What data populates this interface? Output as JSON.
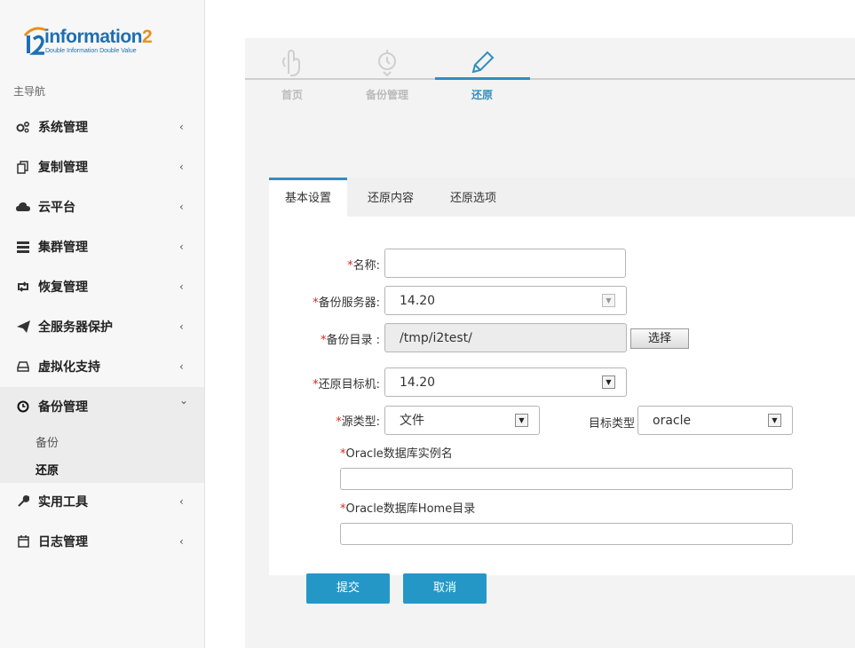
{
  "brand": {
    "logo_text": "information",
    "logo_two": "2",
    "logo_sub": "Double Information Double Value",
    "logo_mark": "i2"
  },
  "sidebar": {
    "title": "主导航",
    "items": [
      {
        "label": "系统管理",
        "icon": "gears-icon"
      },
      {
        "label": "复制管理",
        "icon": "copy-icon"
      },
      {
        "label": "云平台",
        "icon": "cloud-icon"
      },
      {
        "label": "集群管理",
        "icon": "server-icon"
      },
      {
        "label": "恢复管理",
        "icon": "retweet-icon"
      },
      {
        "label": "全服务器保护",
        "icon": "paper-plane-icon"
      },
      {
        "label": "虚拟化支持",
        "icon": "hdd-icon"
      },
      {
        "label": "备份管理",
        "icon": "clock-icon"
      },
      {
        "label": "实用工具",
        "icon": "wrench-icon"
      },
      {
        "label": "日志管理",
        "icon": "calendar-icon"
      }
    ],
    "chevron": "‹",
    "chevron_open": "⌄",
    "sub_items": [
      {
        "label": "备份"
      },
      {
        "label": "还原"
      }
    ]
  },
  "steps": [
    {
      "label": "首页",
      "icon": "hand-pointer-icon"
    },
    {
      "label": "备份管理",
      "icon": "stopwatch-icon"
    },
    {
      "label": "还原",
      "icon": "pencil-icon"
    }
  ],
  "tabs": [
    {
      "label": "基本设置"
    },
    {
      "label": "还原内容"
    },
    {
      "label": "还原选项"
    }
  ],
  "form": {
    "required_mark": "*",
    "name_label": "名称:",
    "name_value": "",
    "server_label": "备份服务器:",
    "server_value": "14.20",
    "dir_label": "备份目录 :",
    "dir_value": "/tmp/i2test/",
    "choose_button": "选择",
    "target_label": "还原目标机:",
    "target_value": "14.20",
    "source_type_label": "源类型:",
    "source_type_value": "文件",
    "target_type_label": "目标类型",
    "target_type_value": "oracle",
    "oracle_instance_label": "Oracle数据库实例名",
    "oracle_instance_value": "",
    "oracle_home_label": "Oracle数据库Home目录",
    "oracle_home_value": ""
  },
  "actions": {
    "submit": "提交",
    "cancel": "取消"
  },
  "colors": {
    "accent": "#2f8fbd",
    "button": "#2597c7",
    "required": "#d9261c",
    "brand_blue": "#1e6fb3",
    "brand_orange": "#e8901e"
  }
}
